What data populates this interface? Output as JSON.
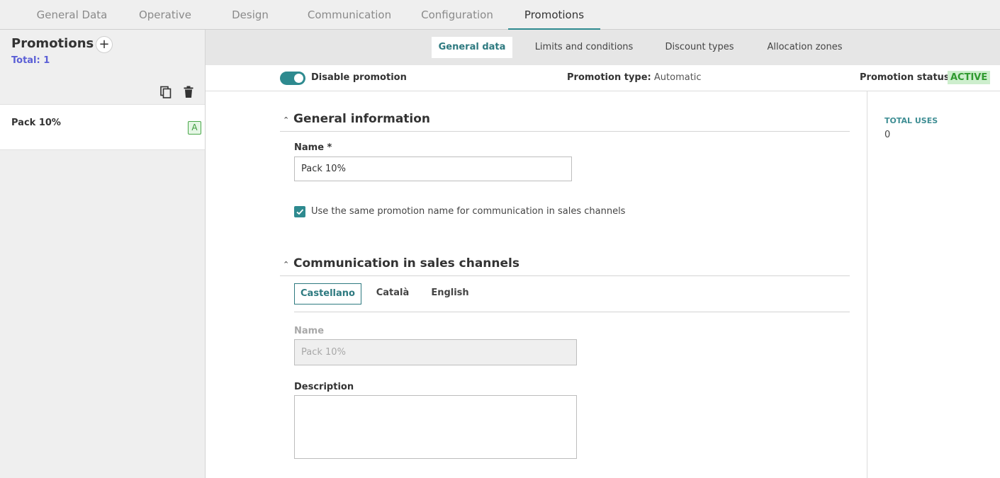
{
  "top_tabs": [
    {
      "label": "General Data"
    },
    {
      "label": "Operative"
    },
    {
      "label": "Design"
    },
    {
      "label": "Communication"
    },
    {
      "label": "Configuration"
    },
    {
      "label": "Promotions",
      "active": true
    }
  ],
  "sidebar": {
    "title": "Promotions",
    "add_icon": "plus-icon",
    "total": "Total: 1",
    "copy_icon": "copy-icon",
    "delete_icon": "trash-icon",
    "items": [
      {
        "name": "Pack 10%",
        "badge": "A"
      }
    ]
  },
  "sub_tabs": [
    {
      "label": "General data",
      "active": true
    },
    {
      "label": "Limits and conditions"
    },
    {
      "label": "Discount types"
    },
    {
      "label": "Allocation zones"
    }
  ],
  "status_bar": {
    "toggle_label": "Disable promotion",
    "toggle_on": true,
    "type_label": "Promotion type:",
    "type_value": "Automatic",
    "status_label": "Promotion status:",
    "status_value": "ACTIVE"
  },
  "stats": {
    "total_uses_label": "TOTAL USES",
    "total_uses_value": "0"
  },
  "general_info": {
    "title": "General information",
    "name_label": "Name *",
    "name_value": "Pack 10%",
    "same_name_checkbox_label": "Use the same promotion name for communication in sales channels",
    "same_name_checked": true
  },
  "communication": {
    "title": "Communication in sales channels",
    "languages": [
      {
        "label": "Castellano",
        "active": true
      },
      {
        "label": "Català"
      },
      {
        "label": "English"
      }
    ],
    "name_label": "Name",
    "name_value": "Pack 10%",
    "description_label": "Description",
    "description_value": ""
  },
  "colors": {
    "accent": "#2e8a8f",
    "status_active_bg": "#cdeecd",
    "status_active_text": "#2f9a2f",
    "total_text": "#5b5fd6"
  }
}
